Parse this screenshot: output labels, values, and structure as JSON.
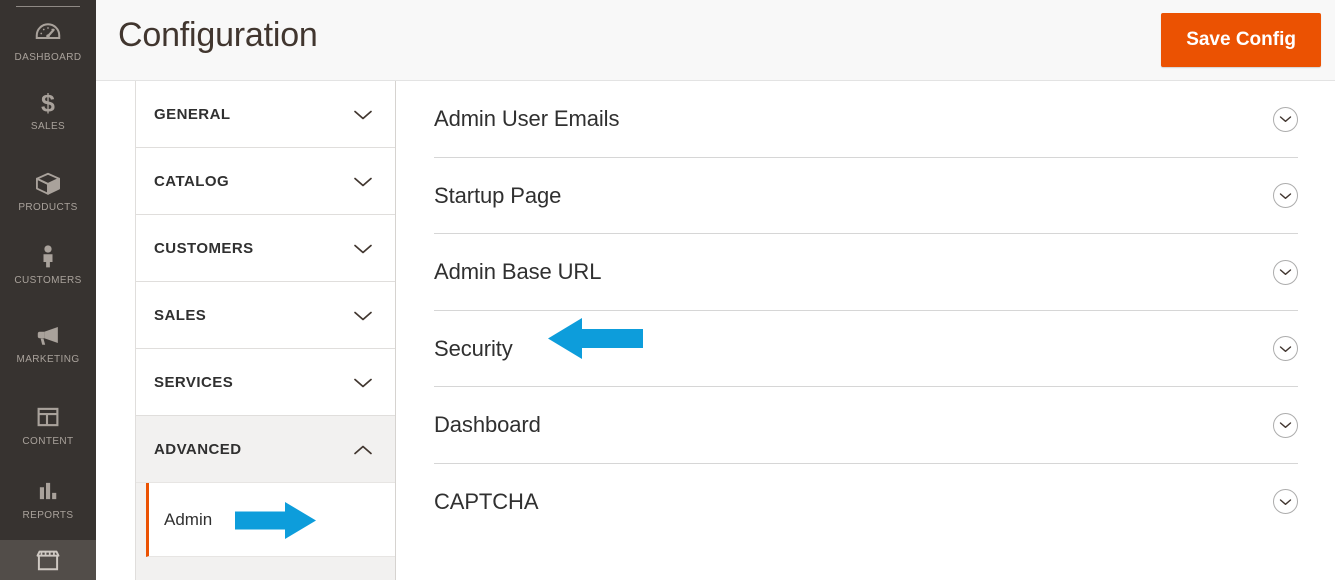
{
  "app": {
    "accent_orange": "#eb5202",
    "sidebar_bg": "#373330",
    "annotation_blue": "#0d9ddb"
  },
  "sidebar": {
    "items": [
      {
        "label": "DASHBOARD",
        "icon": "dashboard-gauge-icon",
        "active": false
      },
      {
        "label": "SALES",
        "icon": "dollar-sign-icon",
        "active": false
      },
      {
        "label": "PRODUCTS",
        "icon": "box-icon",
        "active": false
      },
      {
        "label": "CUSTOMERS",
        "icon": "person-icon",
        "active": false
      },
      {
        "label": "MARKETING",
        "icon": "megaphone-icon",
        "active": false
      },
      {
        "label": "CONTENT",
        "icon": "layout-window-icon",
        "active": false
      },
      {
        "label": "REPORTS",
        "icon": "bar-chart-icon",
        "active": false
      },
      {
        "label": "",
        "icon": "storefront-icon",
        "active": true
      }
    ]
  },
  "header": {
    "title": "Configuration",
    "save_label": "Save Config"
  },
  "config_nav": {
    "sections": [
      {
        "label": "GENERAL",
        "expanded": false,
        "chevron": "chevron-down-icon"
      },
      {
        "label": "CATALOG",
        "expanded": false,
        "chevron": "chevron-down-icon"
      },
      {
        "label": "CUSTOMERS",
        "expanded": false,
        "chevron": "chevron-down-icon"
      },
      {
        "label": "SALES",
        "expanded": false,
        "chevron": "chevron-down-icon"
      },
      {
        "label": "SERVICES",
        "expanded": false,
        "chevron": "chevron-down-icon"
      },
      {
        "label": "ADVANCED",
        "expanded": true,
        "chevron": "chevron-up-icon"
      }
    ],
    "advanced_children": [
      {
        "label": "Admin",
        "selected": true
      }
    ]
  },
  "content": {
    "groups": [
      {
        "title": "Admin User Emails",
        "toggle": "chevron-down-circle-icon"
      },
      {
        "title": "Startup Page",
        "toggle": "chevron-down-circle-icon"
      },
      {
        "title": "Admin Base URL",
        "toggle": "chevron-down-circle-icon"
      },
      {
        "title": "Security",
        "toggle": "chevron-down-circle-icon"
      },
      {
        "title": "Dashboard",
        "toggle": "chevron-down-circle-icon"
      },
      {
        "title": "CAPTCHA",
        "toggle": "chevron-down-circle-icon"
      }
    ]
  },
  "annotations": [
    {
      "name": "arrow-pointing-left-at-security",
      "direction": "left"
    },
    {
      "name": "arrow-pointing-right-at-admin",
      "direction": "right"
    }
  ]
}
